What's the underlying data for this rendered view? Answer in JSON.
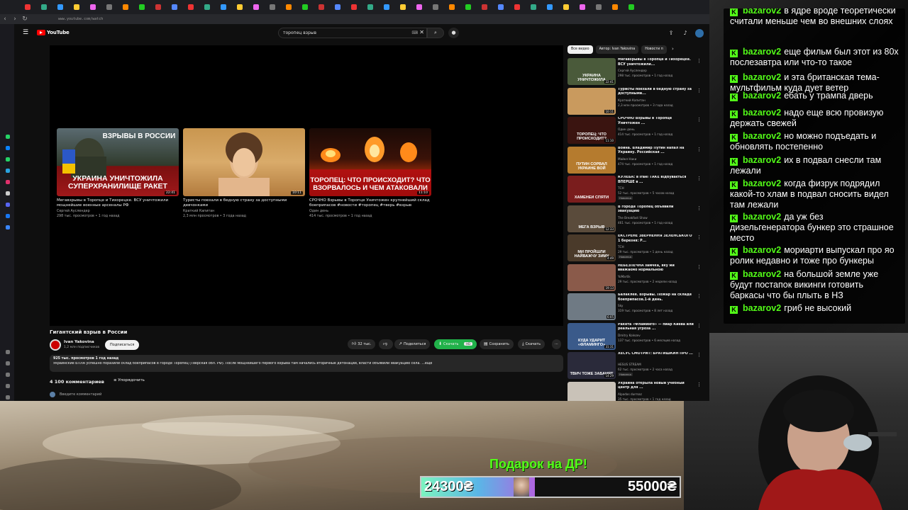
{
  "browser": {
    "url": "www.youtube.com/watch"
  },
  "youtube": {
    "logo_text": "YouTube",
    "search": {
      "query": "торопец взрыв"
    },
    "end_screen": [
      {
        "title": "Мегавзрывы в Торопце и Тихорецке. ВСУ уничтожили мощнейшие военные арсеналы РФ",
        "channel": "Сергей Ауслендер",
        "meta": "298 тыс. просмотров • 1 год назад",
        "duration": "22:41",
        "overlay_top": "ВЗРЫВЫ В РОССИИ",
        "overlay_bottom": "УКРАИНА УНИЧТОЖИЛА СУПЕРХРАНИЛИЩЕ РАКЕТ"
      },
      {
        "title": "Туристы поехали в бедную страну за доступными девчонками",
        "channel": "Краткий Капитан",
        "meta": "2,3 млн просмотров • 3 года назад",
        "duration": "10:11"
      },
      {
        "title": "СРОЧНО Взрывы в Торопце Уничтожен крупнейший склад боеприпасов #новости #торопец #тверь #взрыв",
        "channel": "Один день",
        "meta": "414 тыс. просмотров • 1 год назад",
        "duration": "11:10",
        "overlay_bottom": "ТОРОПЕЦ: ЧТО ПРОИСХОДИТ? ЧТО ВЗОРВАЛОСЬ И ЧЕМ АТАКОВАЛИ"
      }
    ],
    "video": {
      "title": "Гигантский взрыв в России",
      "channel": "Ivan Yakovina",
      "subscribers": "1,2 млн подписчиков",
      "subscribe_label": "Подписаться",
      "likes": "32 тыс.",
      "share_label": "Поделиться",
      "download_green_label": "Скачать",
      "download_green_badge": "HD",
      "save_label": "Сохранить",
      "download_label": "Скачать",
      "desc_meta": "925 тыс. просмотров  1 год назад",
      "desc_text": "Украинские БПЛА успешно поразили склад боеприпасов в городе Торопец (Тверская обл. РФ). После мощнейшего первого взрыва там начались вторичные детонации, власти объявили эвакуацию села. ...ещё",
      "comments_count": "4 100 комментариев",
      "sort_label": "Упорядочить",
      "comment_placeholder": "Введите комментарий"
    },
    "chips": [
      "Все видео",
      "Автор: Ivan Yakovina",
      "Новости п"
    ],
    "sidebar": [
      {
        "title": "Мегавзрывы в Торопце и Тихорецке. ВСУ уничтожили...",
        "channel": "Сергей Ауслендер",
        "meta": "298 тыс. просмотров • 1 год назад",
        "duration": "22:41",
        "thumb_text": "УКРАИНА УНИЧТОЖИЛА",
        "bg": "#4a5a3a"
      },
      {
        "title": "Туристы поехали в бедную страну за доступными...",
        "channel": "Краткий Капитан",
        "meta": "2,3 млн просмотров • 3 года назад",
        "duration": "10:11",
        "thumb_text": "",
        "bg": "#c99a5e"
      },
      {
        "title": "СРОЧНО Взрывы в Торопце Уничтожен ...",
        "channel": "Один день",
        "meta": "414 тыс. просмотров • 1 год назад",
        "duration": "11:10",
        "thumb_text": "ТОРОПЕЦ: ЧТО ПРОИСХОДИТ?",
        "bg": "#3a1410"
      },
      {
        "title": "Война. Владимир Путин напал на Украину. Российская ...",
        "channel": "Майкл Наки",
        "meta": "474 тыс. просмотров • 1 год назад",
        "duration": "",
        "thumb_text": "ПУТИН СОРВАЛ УКРАИНЕ ВОЙ",
        "bg": "#b57b2e"
      },
      {
        "title": "КУЛЕБА: в Irані ТАКЕ відбувається ВПЕРШЕ в ...",
        "channel": "ТСН",
        "meta": "52 тыс. просмотров • 5 часов назад",
        "duration": "",
        "badge": "Новинка",
        "thumb_text": "ХАМЕНЕИ СПЯТИ",
        "bg": "#7a1d1d"
      },
      {
        "title": "В городе Торопец объявили эвакуацию",
        "channel": "The Breakfast Show",
        "meta": "461 тыс. просмотров • 1 год назад",
        "duration": "12:33",
        "thumb_text": "МЕГА ВЗРЫВ",
        "bg": "#5a4b3b"
      },
      {
        "title": "ЕКСТРЕНЕ ЗВЕРНЕННЯ ЗЕЛЕНСЬКОГО 1 березня: Р...",
        "channel": "ТСН",
        "meta": "29 тыс. просмотров • 1 день назад",
        "duration": "4:49",
        "badge": "Новинка",
        "thumb_text": "МИ ПРОЙШЛИ НАЙВАЖЧУ ЗИМУ",
        "bg": "#4a3a2a"
      },
      {
        "title": "НЕБЕЗПЕЧНА замчка, яку ми вважаємо нормальною",
        "channel": "YoMartik",
        "meta": "29 тыс. просмотров • 2 недели назад",
        "duration": "19:13",
        "thumb_text": "",
        "bg": "#8a5a4a"
      },
      {
        "title": "Балаклея. Взрывы. Пожар на складе боеприпасов.1-й день.",
        "channel": "Sky",
        "meta": "319 тыс. просмотров • 8 лет назад",
        "duration": "6:05",
        "thumb_text": "",
        "bg": "#6f7a84"
      },
      {
        "title": "Ракета «Фламинго» — пиар Киева или реальная угроза ...",
        "channel": "Dmitry Kolezev",
        "meta": "137 тыс. просмотров • 6 месяцев назад",
        "duration": "31:31",
        "thumb_text": "КУДА УДАРИТ «ФЛАМИНГО»",
        "bg": "#3a5a8a"
      },
      {
        "title": "ХЕСУС СМОТРИТ: БРАТИШКИН ПРО ...",
        "channel": "HESUS STREAM",
        "meta": "62 тыс. просмотров • 2 часа назад",
        "duration": "14:29",
        "badge": "Новинка",
        "thumb_text": "ТВИЧ ТОЖЕ ЗАБАНЯТ",
        "bg": "#2a2a3a"
      },
      {
        "title": "Украина открыла новый учебный центр для ...",
        "channel": "Alpadas durmaz",
        "meta": "35 тыс. просмотров • 1 год назад",
        "duration": "",
        "thumb_text": "",
        "bg": "#c9c2b8"
      }
    ]
  },
  "chat": {
    "messages": [
      {
        "user": "",
        "text": "в ядре вроде теоретически считали меньше чем во внешних слоях",
        "partial_user": "bazarov2"
      },
      {
        "user": "bazarov2",
        "text": "еще фильм был этот из 80х послезавтра или что-то такое"
      },
      {
        "user": "bazarov2",
        "text": "и эта британская тема-мультфильм куда дует ветер"
      },
      {
        "user": "bazarov2",
        "text": "ебать у трампа дверь"
      },
      {
        "user": "bazarov2",
        "text": "надо еще всю провизую держать свежей"
      },
      {
        "user": "bazarov2",
        "text": "но можно подъедать и обновлять постепенно"
      },
      {
        "user": "bazarov2",
        "text": "их в подвал снесли там лежали"
      },
      {
        "user": "bazarov2",
        "text": "когда физрук подрядил какой-то хлам в подвал сносить видел там лежали"
      },
      {
        "user": "bazarov2",
        "text": "да уж без дизельгенератора бункер это страшное место"
      },
      {
        "user": "bazarov2",
        "text": "мориарти выпускал про яо ролик недавно и тоже про бункеры"
      },
      {
        "user": "bazarov2",
        "text": "на большой земле уже будут постапок викинги готовить баркасы что бы плыть в НЗ"
      },
      {
        "user": "bazarov2",
        "text": "гриб не высокий"
      }
    ]
  },
  "goal": {
    "title": "Подарок на ДР!",
    "current": "24300₴",
    "target": "55000₴",
    "progress": 0.44
  }
}
